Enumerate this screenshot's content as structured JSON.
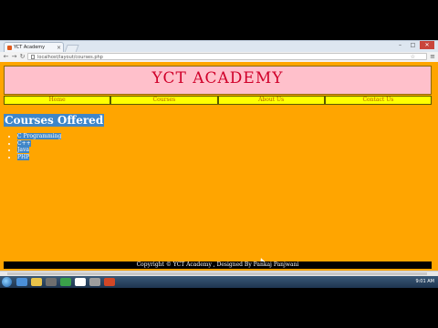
{
  "browser": {
    "tab_title": "YCT Academy",
    "tab_close": "×",
    "url": "localhost/layout/courses.php",
    "back": "←",
    "forward": "→",
    "reload": "↻",
    "star": "☆",
    "menu": "≡",
    "window_controls": {
      "minimize": "–",
      "maximize": "□",
      "close": "✕"
    }
  },
  "page": {
    "site_title": "YCT ACADEMY",
    "nav": [
      "Home",
      "Courses",
      "About Us",
      "Contact Us"
    ],
    "section_title": "Courses Offered",
    "courses": [
      "C Programming",
      "C++",
      "Java",
      "PHP"
    ],
    "footer": "Copyright © YCT Academy , Designed By Pankaj Panjwani"
  },
  "taskbar": {
    "clock": "9:01 AM"
  },
  "colors": {
    "page_bg": "#ffa500",
    "header_bg": "#ffc0cb",
    "title": "#d0002a",
    "nav_bg": "#ffff00",
    "selection": "#3f86c8"
  }
}
